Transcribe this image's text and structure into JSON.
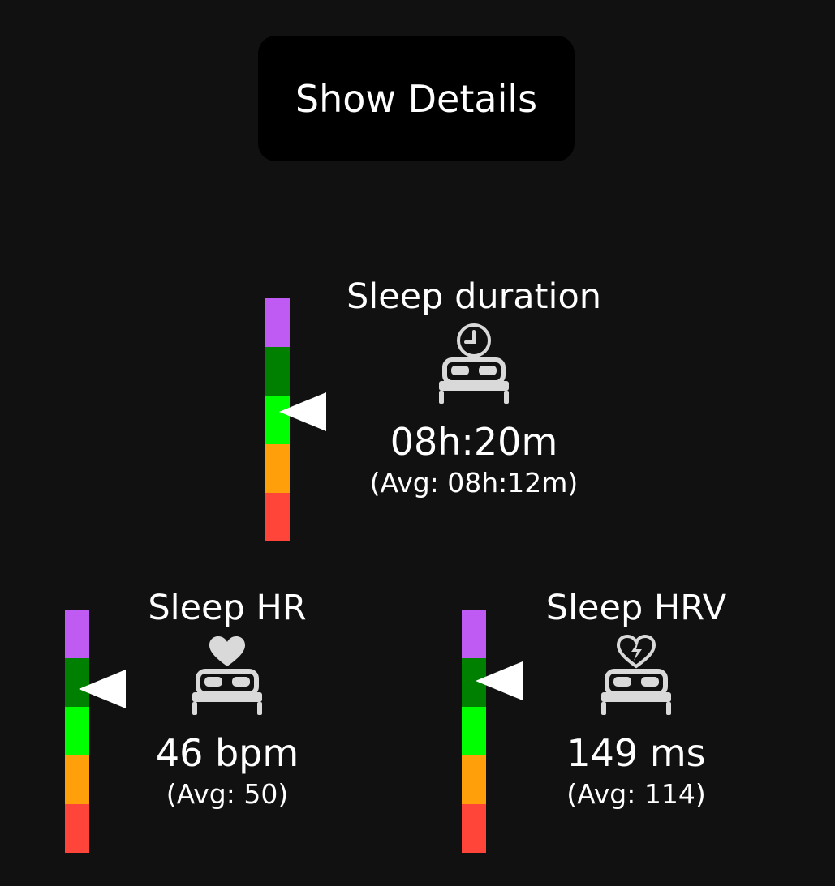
{
  "show_details_label": "Show Details",
  "scale_colors": [
    "#bf5af2",
    "#008000",
    "#00ff00",
    "#ff9f0a",
    "#ff453a"
  ],
  "metrics": [
    {
      "id": "sleep-duration",
      "title": "Sleep duration",
      "icon": "bed-clock-icon",
      "value": "08h:20m",
      "avg": "(Avg: 08h:12m)",
      "level_segment": 2
    },
    {
      "id": "sleep-hr",
      "title": "Sleep HR",
      "icon": "bed-heart-icon",
      "value": "46 bpm",
      "avg": "(Avg: 50)",
      "level_segment": 1
    },
    {
      "id": "sleep-hrv",
      "title": "Sleep HRV",
      "icon": "bed-bolt-heart-icon",
      "value": "149 ms",
      "avg": "(Avg: 114)",
      "level_segment": 1
    }
  ]
}
